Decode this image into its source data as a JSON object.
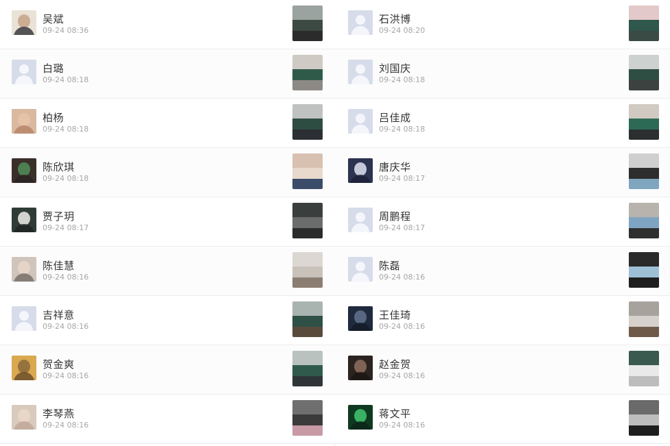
{
  "left_column": [
    {
      "name": "吴斌",
      "time": "09-24 08:36",
      "avatar": {
        "kind": "photo",
        "bg": "#e9e2d6",
        "face": "#c9a78c",
        "shoulder": "#3a3a40"
      },
      "thumb": [
        "#9aa39f",
        "#3d4a44",
        "#2b2b2b"
      ]
    },
    {
      "name": "白璐",
      "time": "09-24 08:18",
      "avatar": {
        "kind": "placeholder"
      },
      "thumb": [
        "#cfcac4",
        "#2f5a4a",
        "#8d8a86"
      ]
    },
    {
      "name": "柏杨",
      "time": "09-24 08:18",
      "avatar": {
        "kind": "photo",
        "bg": "#d9b9a0",
        "face": "#e7c3a6",
        "shoulder": "#b9866a"
      },
      "thumb": [
        "#bfc2c0",
        "#2e4d42",
        "#2c2f33"
      ]
    },
    {
      "name": "陈欣琪",
      "time": "09-24 08:18",
      "avatar": {
        "kind": "photo",
        "bg": "#3b2f2a",
        "face": "#4f8a55",
        "shoulder": "#2a2322"
      },
      "thumb": [
        "#d8c1b0",
        "#e9d8cc",
        "#3b4c6b"
      ]
    },
    {
      "name": "贾子玥",
      "time": "09-24 08:17",
      "avatar": {
        "kind": "photo",
        "bg": "#2f3b35",
        "face": "#e4e4e0",
        "shoulder": "#1f2623"
      },
      "thumb": [
        "#3a3f3e",
        "#6a6d6b",
        "#2a2c2c"
      ]
    },
    {
      "name": "陈佳慧",
      "time": "09-24 08:16",
      "avatar": {
        "kind": "photo",
        "bg": "#cfc5bd",
        "face": "#e8d6c8",
        "shoulder": "#7a6f6a"
      },
      "thumb": [
        "#dcd7d2",
        "#c9c2bb",
        "#8c7d72"
      ]
    },
    {
      "name": "吉祥意",
      "time": "09-24 08:16",
      "avatar": {
        "kind": "placeholder"
      },
      "thumb": [
        "#a9b3b0",
        "#2e5046",
        "#5a4a3c"
      ]
    },
    {
      "name": "贺金爽",
      "time": "09-24 08:16",
      "avatar": {
        "kind": "photo",
        "bg": "#d9a84f",
        "face": "#8e6b3c",
        "shoulder": "#6b4f2a"
      },
      "thumb": [
        "#b9c2bf",
        "#2f5a4c",
        "#2e3438"
      ]
    },
    {
      "name": "李琴燕",
      "time": "09-24 08:16",
      "avatar": {
        "kind": "photo",
        "bg": "#d8cabd",
        "face": "#ead7c9",
        "shoulder": "#c1a79a"
      },
      "thumb": [
        "#6f6f6f",
        "#3b3b3b",
        "#c79aa6"
      ]
    }
  ],
  "right_column": [
    {
      "name": "石洪博",
      "time": "09-24 08:20",
      "avatar": {
        "kind": "placeholder"
      },
      "thumb": [
        "#e3c9c9",
        "#2f574c",
        "#3a4b46"
      ]
    },
    {
      "name": "刘国庆",
      "time": "09-24 08:18",
      "avatar": {
        "kind": "placeholder"
      },
      "thumb": [
        "#cdd1cf",
        "#2e4e44",
        "#3d4240"
      ]
    },
    {
      "name": "吕佳成",
      "time": "09-24 08:18",
      "avatar": {
        "kind": "placeholder"
      },
      "thumb": [
        "#d0cac2",
        "#2d6a56",
        "#2b2f30"
      ]
    },
    {
      "name": "唐庆华",
      "time": "09-24 08:17",
      "avatar": {
        "kind": "photo",
        "bg": "#2c3350",
        "face": "#d5d8e8",
        "shoulder": "#1d2238"
      },
      "thumb": [
        "#cfcfcf",
        "#2d2d2d",
        "#7fa6bf"
      ]
    },
    {
      "name": "周鹏程",
      "time": "09-24 08:17",
      "avatar": {
        "kind": "placeholder"
      },
      "thumb": [
        "#b8b3ad",
        "#7fa4c1",
        "#2f2f2f"
      ]
    },
    {
      "name": "陈磊",
      "time": "09-24 08:16",
      "avatar": {
        "kind": "placeholder"
      },
      "thumb": [
        "#2a2a2a",
        "#9ec0d6",
        "#1e1e1e"
      ]
    },
    {
      "name": "王佳琦",
      "time": "09-24 08:16",
      "avatar": {
        "kind": "photo",
        "bg": "#1f2a3d",
        "face": "#5d6e88",
        "shoulder": "#141b28"
      },
      "thumb": [
        "#a8a29c",
        "#d6d1cc",
        "#6f5a4a"
      ]
    },
    {
      "name": "赵金贺",
      "time": "09-24 08:16",
      "avatar": {
        "kind": "photo",
        "bg": "#2b2320",
        "face": "#8a6a5a",
        "shoulder": "#1c1614"
      },
      "thumb": [
        "#3b5a4f",
        "#e9e9e9",
        "#bdbdbd"
      ]
    },
    {
      "name": "蒋文平",
      "time": "09-24 08:16",
      "avatar": {
        "kind": "photo",
        "bg": "#0f3a22",
        "face": "#3fbf6a",
        "shoulder": "#0b2616"
      },
      "thumb": [
        "#6a6a6a",
        "#bdbdbd",
        "#1e1e1e"
      ]
    }
  ]
}
